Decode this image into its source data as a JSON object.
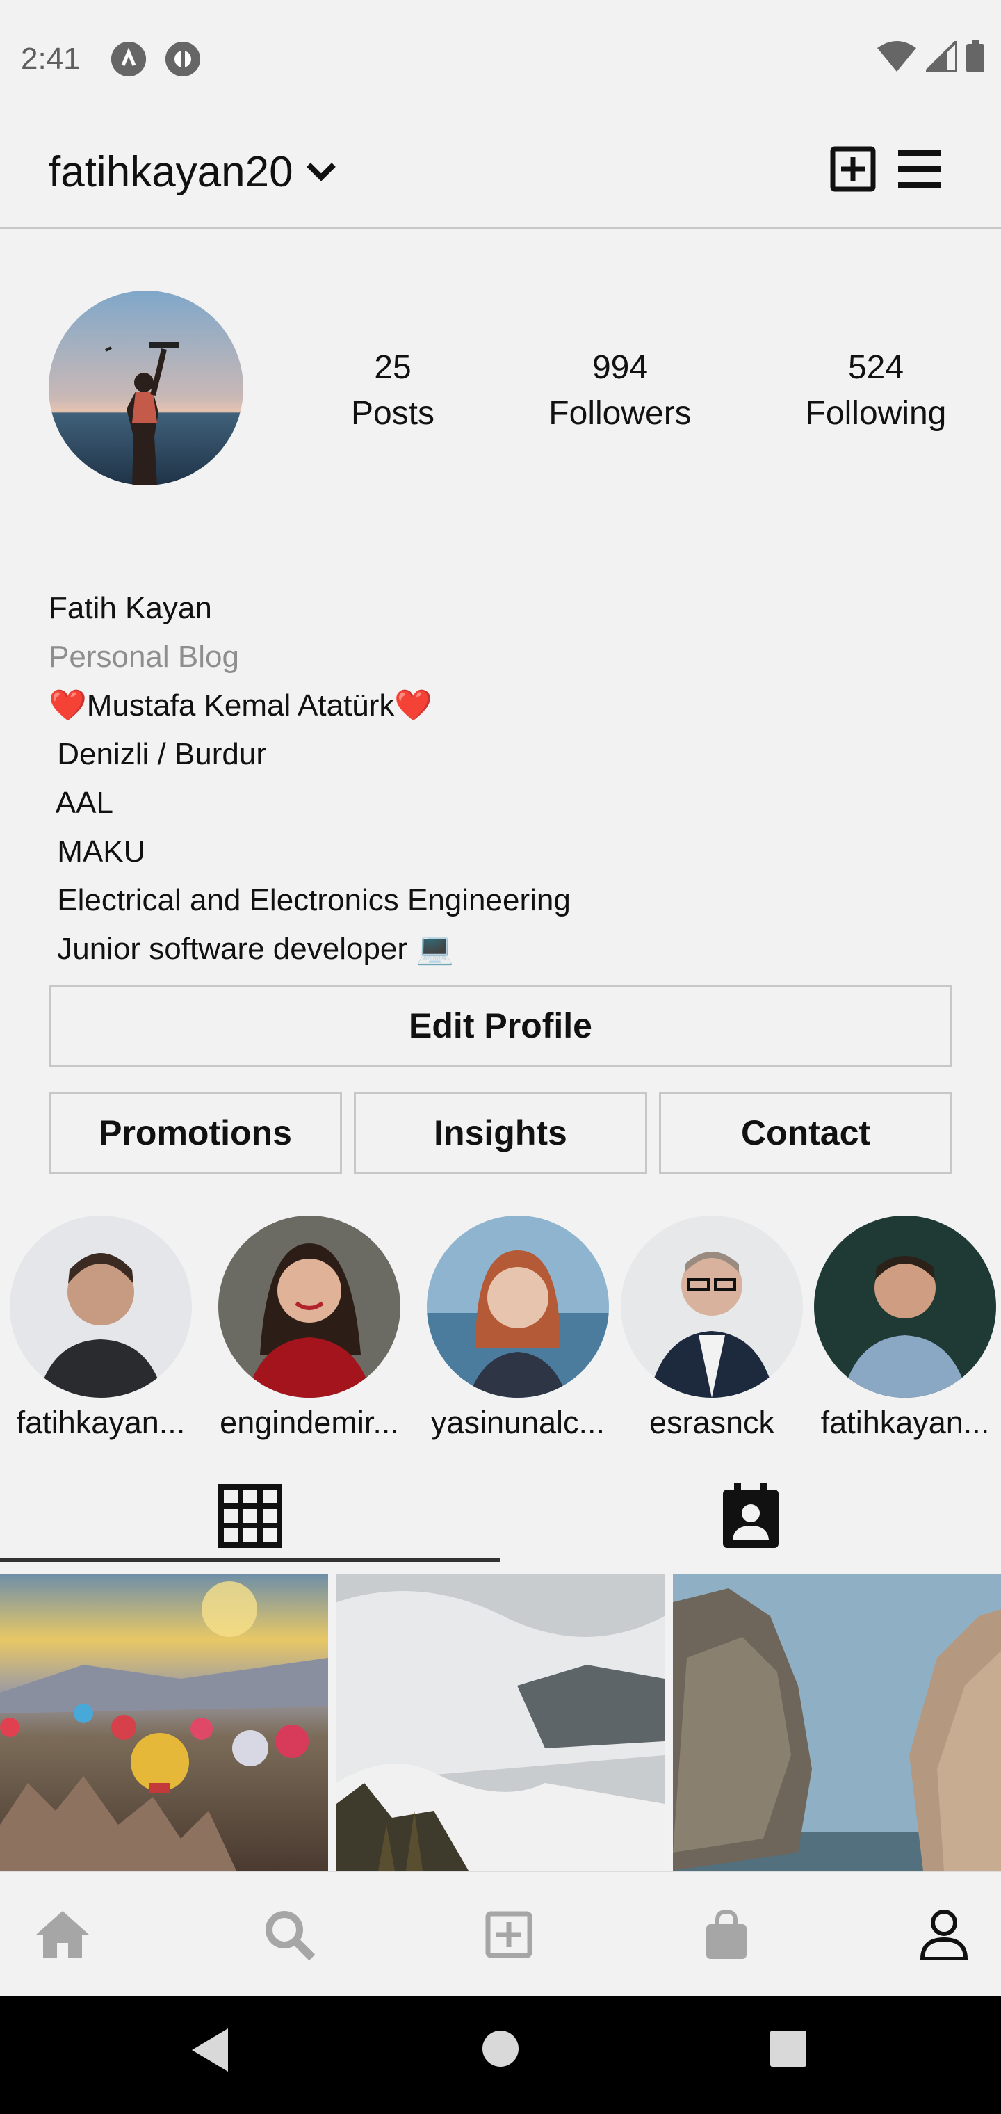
{
  "status_bar": {
    "time": "2:41"
  },
  "header": {
    "username": "fatihkayan20"
  },
  "profile": {
    "stats": [
      {
        "value": "25",
        "label": "Posts"
      },
      {
        "value": "994",
        "label": "Followers"
      },
      {
        "value": "524",
        "label": "Following"
      }
    ],
    "bio": {
      "name": "Fatih Kayan",
      "category": "Personal Blog",
      "lines": [
        "❤️Mustafa Kemal Atatürk❤️",
        " Denizli / Burdur",
        " AAL",
        " MAKU",
        " Electrical and Electronics Engineering",
        " Junior software developer 💻"
      ]
    }
  },
  "buttons": {
    "edit_profile": "Edit Profile",
    "promotions": "Promotions",
    "insights": "Insights",
    "contact": "Contact"
  },
  "highlights": [
    {
      "label": "fatihkayan..."
    },
    {
      "label": "engindemir..."
    },
    {
      "label": "yasinunalc..."
    },
    {
      "label": "esrasnck"
    },
    {
      "label": "fatihkayan..."
    }
  ],
  "tabs": [
    {
      "icon": "grid-icon",
      "active": true
    },
    {
      "icon": "tagged-contact-icon",
      "active": false
    }
  ],
  "bottom_nav": [
    {
      "icon": "home-icon"
    },
    {
      "icon": "search-icon"
    },
    {
      "icon": "add-post-icon"
    },
    {
      "icon": "shop-bag-icon"
    },
    {
      "icon": "profile-icon",
      "active": true
    }
  ],
  "colors": {
    "background": "#f2f2f2",
    "muted_text": "#8e8e8e",
    "border": "#c7c7c7",
    "nav_inactive": "#a6a6a6"
  }
}
